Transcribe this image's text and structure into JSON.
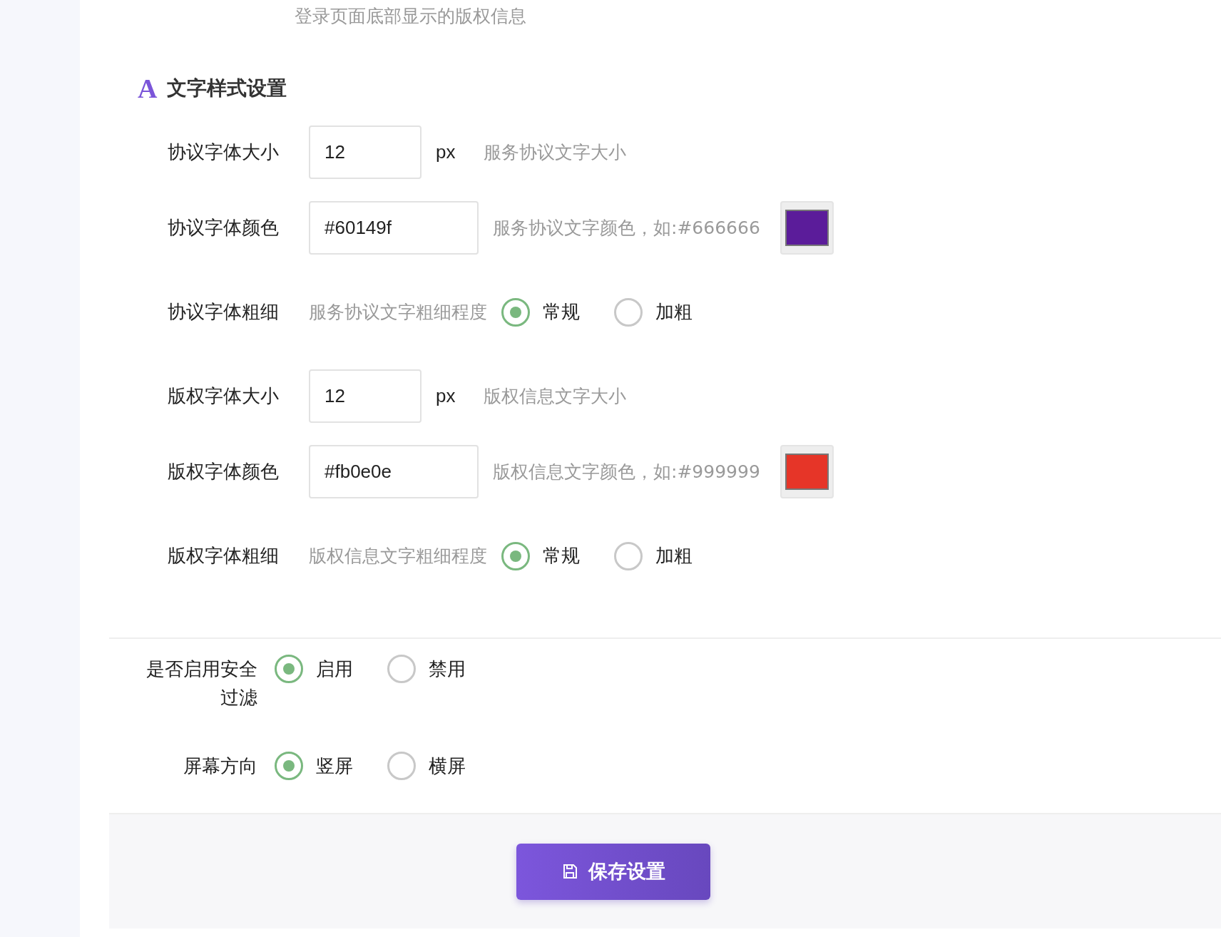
{
  "top_hint": "登录页面底部显示的版权信息",
  "text_style_section": {
    "icon": "A",
    "title": "文字样式设置",
    "rows": [
      {
        "kind": "size",
        "label": "协议字体大小",
        "value": "12",
        "unit": "px",
        "hint": "服务协议文字大小"
      },
      {
        "kind": "color",
        "label": "协议字体颜色",
        "value": "#60149f",
        "hint": "服务协议文字颜色，如:#666666",
        "color": "#5b1c9a"
      },
      {
        "kind": "weight",
        "label": "协议字体粗细",
        "hint": "服务协议文字粗细程度",
        "options": [
          {
            "label": "常规",
            "selected": true
          },
          {
            "label": "加粗",
            "selected": false
          }
        ]
      },
      {
        "kind": "size",
        "label": "版权字体大小",
        "value": "12",
        "unit": "px",
        "hint": "版权信息文字大小"
      },
      {
        "kind": "color",
        "label": "版权字体颜色",
        "value": "#fb0e0e",
        "hint": "版权信息文字颜色，如:#999999",
        "color": "#e63528"
      },
      {
        "kind": "weight",
        "label": "版权字体粗细",
        "hint": "版权信息文字粗细程度",
        "options": [
          {
            "label": "常规",
            "selected": true
          },
          {
            "label": "加粗",
            "selected": false
          }
        ]
      }
    ]
  },
  "settings": [
    {
      "label": "是否启用安全过滤",
      "options": [
        {
          "label": "启用",
          "selected": true
        },
        {
          "label": "禁用",
          "selected": false
        }
      ]
    },
    {
      "label": "屏幕方向",
      "options": [
        {
          "label": "竖屏",
          "selected": true
        },
        {
          "label": "横屏",
          "selected": false
        }
      ]
    }
  ],
  "save_button": "保存设置"
}
